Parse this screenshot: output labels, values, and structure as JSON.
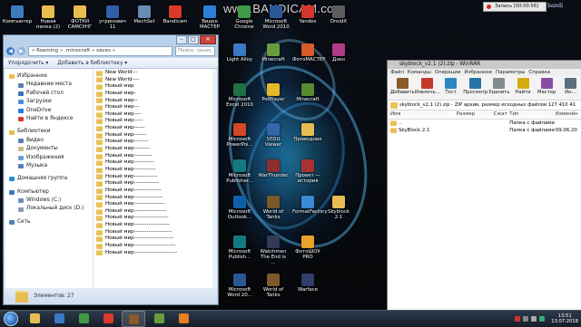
{
  "watermark": "www.BANDICAM.com",
  "recorder": {
    "label": "Запись [00:00:56]"
  },
  "desktop_icons": [
    {
      "label": "Компьютер",
      "color": "#3d7bbf"
    },
    {
      "label": "Новая папка (2)",
      "color": "#e6bd50"
    },
    {
      "label": "ФОТКИ САМСУНГ",
      "color": "#e6bd50"
    },
    {
      "label": "угринович 11",
      "color": "#2f5fa8"
    },
    {
      "label": "MechSet",
      "color": "#6a8bb5"
    },
    {
      "label": "Bandicam",
      "color": "#d93a2b"
    },
    {
      "label": "Видео МАСТЕР",
      "color": "#2c7fd6"
    },
    {
      "label": "Google Chrome",
      "color": "#3f9b46"
    },
    {
      "label": "Microsoft Word 2010",
      "color": "#2b5797"
    },
    {
      "label": "Yandex",
      "color": "#d4362b"
    },
    {
      "label": "DroidX",
      "color": "#5c5c5c"
    },
    {
      "label": "Light Alloy",
      "color": "#3a79c4"
    },
    {
      "label": "Minecraft",
      "color": "#6a9c3d"
    },
    {
      "label": "ФотоМАСТЕР",
      "color": "#d75b2b"
    },
    {
      "label": "Дзен",
      "color": "#b23a8a"
    },
    {
      "label": "Microsoft Excel 2010",
      "color": "#1e7145"
    },
    {
      "label": "PotPlayer",
      "color": "#e8b82b"
    },
    {
      "label": "Minecraft",
      "color": "#5a8a2f"
    },
    {
      "label": "Microsoft PowerPoi...",
      "color": "#d24726"
    },
    {
      "label": "STDU Viewer",
      "color": "#3366aa"
    },
    {
      "label": "Проводник",
      "color": "#e6bd50"
    },
    {
      "label": "Microsoft Publisher...",
      "color": "#137a7f"
    },
    {
      "label": "WarThunder",
      "color": "#8b2f2f"
    },
    {
      "label": "Проект — история",
      "color": "#a83232"
    },
    {
      "label": "Microsoft Outlook...",
      "color": "#0f5ea8"
    },
    {
      "label": "World of Tanks",
      "color": "#7a5a2a"
    },
    {
      "label": "FormatFactory",
      "color": "#3a8ad6"
    },
    {
      "label": "Skyblock 2.1",
      "color": "#e6bd50"
    },
    {
      "label": "Microsoft Publish...",
      "color": "#137a7f"
    },
    {
      "label": "Watchmen The End is ...",
      "color": "#333a55"
    },
    {
      "label": "ФотоШОУ PRO",
      "color": "#e8a12b"
    },
    {
      "label": "Microsoft Word 20...",
      "color": "#2b5797"
    },
    {
      "label": "World of Tanks",
      "color": "#7a5a2a"
    },
    {
      "label": "Warface",
      "color": "#2f3f6a"
    }
  ],
  "explorer": {
    "address": "« Roaming » .minecraft » saves »",
    "search_placeholder": "Поиск: saves",
    "toolbar": {
      "organize": "Упорядочить ▾",
      "add_to_library": "Добавить в библиотеку ▾"
    },
    "nav": [
      {
        "label": "Избранное",
        "kind": "group",
        "color": "#f0c040"
      },
      {
        "label": "Недавние места",
        "kind": "child",
        "color": "#5a7fb5"
      },
      {
        "label": "Рабочий стол",
        "kind": "child",
        "color": "#3a6fb7"
      },
      {
        "label": "Загрузки",
        "kind": "child",
        "color": "#4a90d9"
      },
      {
        "label": "OneDrive",
        "kind": "child",
        "color": "#2a7ae0"
      },
      {
        "label": "Найти в Яндексе",
        "kind": "child",
        "color": "#d93a2b"
      },
      {
        "label": "",
        "kind": "gap",
        "color": ""
      },
      {
        "label": "Библиотеки",
        "kind": "group",
        "color": "#e6bd50"
      },
      {
        "label": "Видео",
        "kind": "child",
        "color": "#5a7fb5"
      },
      {
        "label": "Документы",
        "kind": "child",
        "color": "#c9b88a"
      },
      {
        "label": "Изображения",
        "kind": "child",
        "color": "#6aa0d0"
      },
      {
        "label": "Музыка",
        "kind": "child",
        "color": "#4f80c0"
      },
      {
        "label": "",
        "kind": "gap",
        "color": ""
      },
      {
        "label": "Домашняя группа",
        "kind": "group",
        "color": "#2d8fd8"
      },
      {
        "label": "",
        "kind": "gap",
        "color": ""
      },
      {
        "label": "Компьютер",
        "kind": "group",
        "color": "#3d7bbf"
      },
      {
        "label": "Windows (C:)",
        "kind": "child",
        "color": "#6b8fbf"
      },
      {
        "label": "Локальный диск (D:)",
        "kind": "child",
        "color": "#8a9bb0"
      },
      {
        "label": "",
        "kind": "gap",
        "color": ""
      },
      {
        "label": "Сеть",
        "kind": "group",
        "color": "#4f7fb7"
      }
    ],
    "files": [
      "New World---",
      "New World----",
      "Новый мир",
      "Новый мир-",
      "Новый мир--",
      "Новый мир---",
      "Новый мир----",
      "Новый мир-----",
      "Новый мир------",
      "Новый мир-------",
      "Новый мир--------",
      "Новый мир---------",
      "Новый мир----------",
      "Новый мир-----------",
      "Новый мир------------",
      "Новый мир-------------",
      "Новый мир--------------",
      "Новый мир---------------",
      "Новый мир----------------",
      "Новый мир-----------------",
      "Новый мир------------------",
      "Новый мир-------------------",
      "Новый мир--------------------",
      "Новый мир---------------------",
      "Новый мир----------------------",
      "Новый мир-----------------------",
      "Новый мир------------------------"
    ],
    "status": "Элементов: 27"
  },
  "winrar": {
    "title": "skyblock_v2.1 (2).zip - WinRAR",
    "menu": [
      "Файл",
      "Команды",
      "Операции",
      "Избранное",
      "Параметры",
      "Справка"
    ],
    "tools": [
      {
        "label": "Добавить",
        "color": "#8a5a2a"
      },
      {
        "label": "Извлечь...",
        "color": "#c0392b"
      },
      {
        "label": "Тест",
        "color": "#2e86c1"
      },
      {
        "label": "Просмотр",
        "color": "#2874a6"
      },
      {
        "label": "Удалить",
        "color": "#7f8c8d"
      },
      {
        "label": "Найти",
        "color": "#d4ac0d"
      },
      {
        "label": "Мастер",
        "color": "#884ea0"
      },
      {
        "label": "Ин...",
        "color": "#5d6d7e"
      }
    ],
    "path": "skyblock_v2.1 (2).zip - ZIP архив, размер исходных файлов 127 410 41",
    "columns": [
      "Имя",
      "Размер",
      "Сжат",
      "Тип",
      "Изменён"
    ],
    "rows": [
      {
        "name": "..",
        "size": "",
        "packed": "",
        "type": "Папка с файлами",
        "modified": ""
      },
      {
        "name": "SkyBlock 2.1",
        "size": "",
        "packed": "",
        "type": "Папка с файлами",
        "modified": "09.06.20"
      }
    ]
  },
  "taskbar": {
    "icons": [
      {
        "name": "explorer",
        "color": "#e6bd50"
      },
      {
        "name": "media-player",
        "color": "#3a79c4"
      },
      {
        "name": "chrome",
        "color": "#3f9b46"
      },
      {
        "name": "bandicam",
        "color": "#d93a2b"
      },
      {
        "name": "winrar",
        "color": "#8a5a2a"
      },
      {
        "name": "minecraft",
        "color": "#6a9c3d"
      },
      {
        "name": "vlc",
        "color": "#e67e22"
      }
    ],
    "time": "13:51",
    "date": "13.07.2018"
  }
}
